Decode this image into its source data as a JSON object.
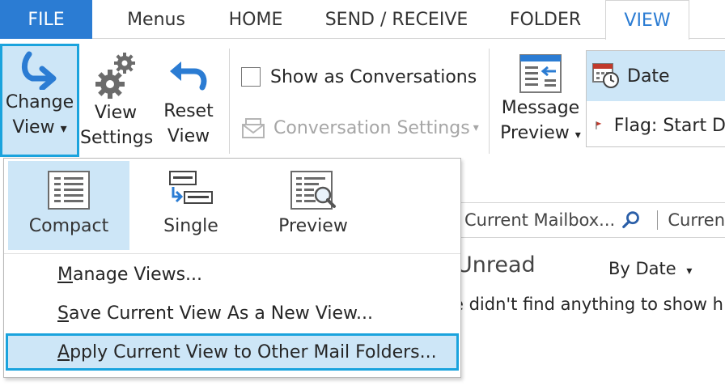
{
  "tabs": {
    "file": "FILE",
    "menus": "Menus",
    "home": "HOME",
    "send_receive": "SEND / RECEIVE",
    "folder": "FOLDER",
    "view": "VIEW"
  },
  "ribbon": {
    "change_view": {
      "line1": "Change",
      "line2": "View",
      "arrow": "▾"
    },
    "view_settings": {
      "line1": "View",
      "line2": "Settings"
    },
    "reset_view": {
      "line1": "Reset",
      "line2": "View"
    },
    "show_as_conversations": "Show as Conversations",
    "conversation_settings": "Conversation Settings",
    "conversation_settings_arrow": "▾",
    "message_preview": {
      "line1": "Message",
      "line2": "Preview",
      "arrow": "▾"
    },
    "arrangement": {
      "date": "Date",
      "flag_start": "Flag: Start D"
    }
  },
  "mail_list": {
    "search_scope": "Current Mailbox...",
    "search_next": "Curren",
    "filter": "Unread",
    "sort": "By Date",
    "sort_arrow": "▾",
    "empty_message": "e didn't find anything to show h"
  },
  "dropdown": {
    "views": [
      {
        "label": "Compact",
        "icon": "compact-view-icon"
      },
      {
        "label": "Single",
        "icon": "single-view-icon"
      },
      {
        "label": "Preview",
        "icon": "preview-view-icon"
      }
    ],
    "manage_views": {
      "accel": "M",
      "rest": "anage Views..."
    },
    "save_view": {
      "accel": "S",
      "rest": "ave Current View As a New View..."
    },
    "apply_view": {
      "accel": "A",
      "rest": "pply Current View to Other Mail Folders..."
    }
  },
  "colors": {
    "accent": "#2b7cd3",
    "selected_bg": "#cde6f7",
    "highlight_border": "#1aa3dd",
    "flag_red": "#c0392b"
  }
}
